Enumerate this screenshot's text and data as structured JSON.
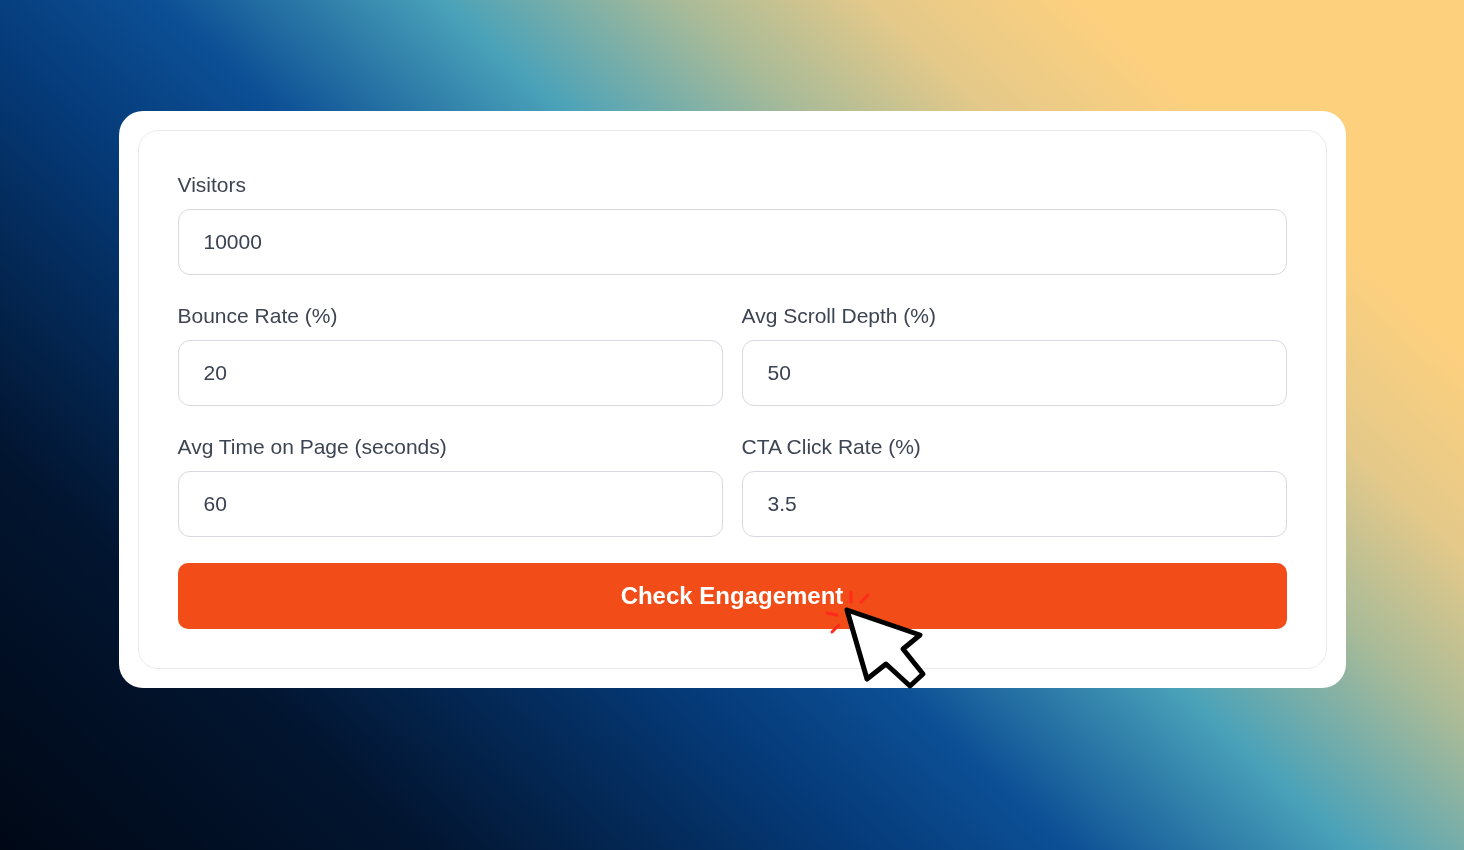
{
  "form": {
    "rows": [
      [
        {
          "label": "Visitors",
          "value": "10000"
        }
      ],
      [
        {
          "label": "Bounce Rate (%)",
          "value": "20"
        },
        {
          "label": "Avg Scroll Depth (%)",
          "value": "50"
        }
      ],
      [
        {
          "label": "Avg Time on Page (seconds)",
          "value": "60"
        },
        {
          "label": "CTA Click Rate (%)",
          "value": "3.5"
        }
      ]
    ],
    "submit_button": "Check Engagement"
  }
}
